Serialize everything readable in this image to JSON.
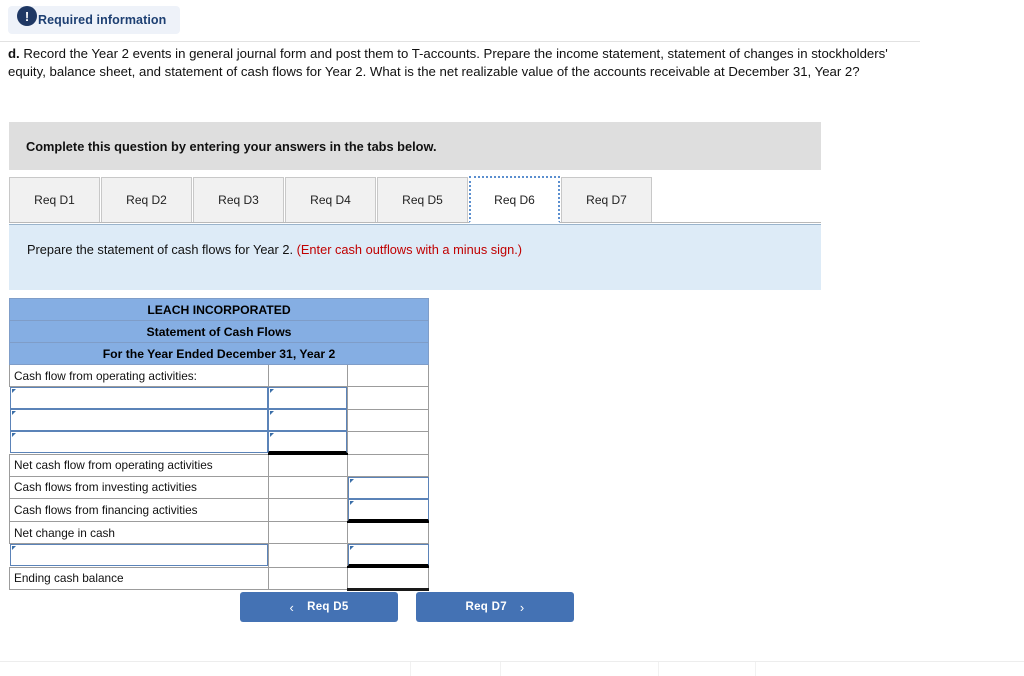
{
  "alert": {
    "icon": "exclamation-icon",
    "label": "Required information"
  },
  "question": {
    "letter": "d.",
    "text": "Record the Year 2 events in general journal form and post them to T-accounts. Prepare the income statement, statement of changes in stockholders' equity, balance sheet, and statement of cash flows for Year 2. What is the net realizable value of the accounts receivable at December 31, Year 2?"
  },
  "instruction_band": {
    "text": "Complete this question by entering your answers in the tabs below."
  },
  "tabs": {
    "active_index": 5,
    "items": [
      {
        "label": "Req D1"
      },
      {
        "label": "Req D2"
      },
      {
        "label": "Req D3"
      },
      {
        "label": "Req D4"
      },
      {
        "label": "Req D5"
      },
      {
        "label": "Req D6"
      },
      {
        "label": "Req D7"
      }
    ]
  },
  "requirement": {
    "text": "Prepare the statement of cash flows for Year 2.",
    "hint": "(Enter cash outflows with a minus sign.)",
    "hint_color": "#c00000"
  },
  "statement": {
    "header_color": "#85aee3",
    "title_lines": [
      "LEACH INCORPORATED",
      "Statement of Cash Flows",
      "For the Year Ended December 31, Year 2"
    ],
    "rows": [
      {
        "label": "Cash flow from operating activities:",
        "label_editable": false,
        "col2": "",
        "col2_editable": false,
        "col3": "",
        "col3_editable": false
      },
      {
        "label": "",
        "label_editable": true,
        "col2": "",
        "col2_editable": true,
        "col3": "",
        "col3_editable": false
      },
      {
        "label": "",
        "label_editable": true,
        "col2": "",
        "col2_editable": true,
        "col3": "",
        "col3_editable": false
      },
      {
        "label": "",
        "label_editable": true,
        "col2": "",
        "col2_editable": true,
        "col3": "",
        "col3_editable": false
      },
      {
        "label": "Net cash flow from operating activities",
        "label_editable": false,
        "col2": "",
        "col2_editable": false,
        "col3": "",
        "col3_editable": false
      },
      {
        "label": "Cash flows from investing activities",
        "label_editable": false,
        "col2": "",
        "col2_editable": false,
        "col3": "",
        "col3_editable": true
      },
      {
        "label": "Cash flows from financing activities",
        "label_editable": false,
        "col2": "",
        "col2_editable": false,
        "col3": "",
        "col3_editable": true
      },
      {
        "label": "Net change in cash",
        "label_editable": false,
        "col2": "",
        "col2_editable": false,
        "col3": "",
        "col3_editable": false
      },
      {
        "label": "",
        "label_editable": true,
        "col2": "",
        "col2_editable": false,
        "col3": "",
        "col3_editable": true
      },
      {
        "label": "Ending cash balance",
        "label_editable": false,
        "col2": "",
        "col2_editable": false,
        "col3": "",
        "col3_editable": false
      }
    ]
  },
  "navigation": {
    "prev_label": "Req D5",
    "prev_chevron": "‹",
    "next_label": "Req D7",
    "next_chevron": "›",
    "button_color": "#4472b4"
  }
}
